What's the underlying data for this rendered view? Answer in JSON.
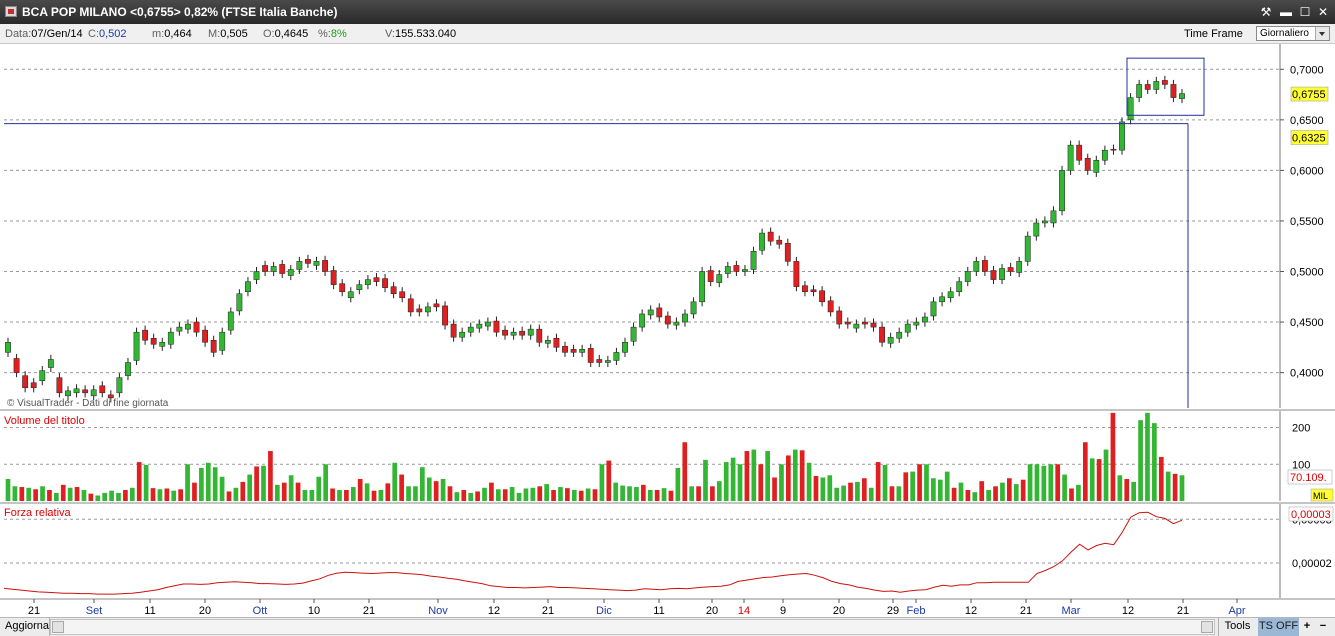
{
  "window": {
    "title": "BCA POP MILANO <0,6755> 0,82%  (FTSE Italia Banche)",
    "controls": {
      "tool": "⚒",
      "minimize": "▬",
      "maximize": "☐",
      "close": "✕"
    }
  },
  "infobar": {
    "data_label": "Data:",
    "data_value": "07/Gen/14",
    "c_label": "C:",
    "c_value": "0,502",
    "m_label": "m:",
    "m_value": "0,464",
    "M_label": "M:",
    "M_value": "0,505",
    "o_label": "O:",
    "o_value": "0,4645",
    "pct_label": "%:",
    "pct_value": "8%",
    "v_label": "V:",
    "v_value": "155.533.040",
    "timeframe_label": "Time Frame",
    "timeframe_value": "Giornaliero"
  },
  "colors": {
    "up": "#33b633",
    "down": "#e02020",
    "grid": "#9a9a9a",
    "rs_line": "#cc1010",
    "label_red": "#dd0000",
    "highlight": "#ffff33",
    "box": "#2030a0"
  },
  "chart_data": [
    {
      "type": "candlestick",
      "watermark": "© VisualTrader - Dati di fine giornata",
      "y_ticks": [
        "0,4000",
        "0,4500",
        "0,5000",
        "0,5500",
        "0,6000",
        "0,6500",
        "0,7000"
      ],
      "ylim": [
        0.365,
        0.725
      ],
      "current_price_label": "0,6755",
      "level_label": "0,6325",
      "x_labels": [
        {
          "label": "21",
          "color": "black"
        },
        {
          "label": "Set",
          "color": "blue"
        },
        {
          "label": "11",
          "color": "black"
        },
        {
          "label": "20",
          "color": "black"
        },
        {
          "label": "Ott",
          "color": "blue"
        },
        {
          "label": "10",
          "color": "black"
        },
        {
          "label": "21",
          "color": "black"
        },
        {
          "label": "Nov",
          "color": "blue"
        },
        {
          "label": "12",
          "color": "black"
        },
        {
          "label": "21",
          "color": "black"
        },
        {
          "label": "Dic",
          "color": "blue"
        },
        {
          "label": "11",
          "color": "black"
        },
        {
          "label": "20",
          "color": "black"
        },
        {
          "label": "14",
          "color": "red"
        },
        {
          "label": "9",
          "color": "black"
        },
        {
          "label": "20",
          "color": "black"
        },
        {
          "label": "29",
          "color": "black"
        },
        {
          "label": "Feb",
          "color": "blue"
        },
        {
          "label": "12",
          "color": "black"
        },
        {
          "label": "21",
          "color": "black"
        },
        {
          "label": "Mar",
          "color": "blue"
        },
        {
          "label": "12",
          "color": "black"
        },
        {
          "label": "21",
          "color": "black"
        },
        {
          "label": "Apr",
          "color": "blue"
        }
      ],
      "close": [
        0.42,
        0.4,
        0.385,
        0.39,
        0.402,
        0.405,
        0.38,
        0.382,
        0.384,
        0.38,
        0.383,
        0.38,
        0.378,
        0.395,
        0.41,
        0.44,
        0.432,
        0.428,
        0.43,
        0.44,
        0.445,
        0.448,
        0.44,
        0.43,
        0.42,
        0.44,
        0.46,
        0.478,
        0.49,
        0.5,
        0.5,
        0.505,
        0.498,
        0.502,
        0.51,
        0.508,
        0.51,
        0.5,
        0.487,
        0.48,
        0.48,
        0.487,
        0.492,
        0.49,
        0.484,
        0.478,
        0.474,
        0.46,
        0.46,
        0.465,
        0.465,
        0.447,
        0.435,
        0.44,
        0.445,
        0.448,
        0.45,
        0.44,
        0.437,
        0.44,
        0.437,
        0.443,
        0.43,
        0.432,
        0.425,
        0.42,
        0.42,
        0.423,
        0.41,
        0.41,
        0.412,
        0.42,
        0.43,
        0.445,
        0.458,
        0.462,
        0.455,
        0.448,
        0.45,
        0.458,
        0.47,
        0.5,
        0.49,
        0.497,
        0.505,
        0.5,
        0.502,
        0.52,
        0.538,
        0.53,
        0.527,
        0.51,
        0.485,
        0.48,
        0.48,
        0.47,
        0.46,
        0.448,
        0.448,
        0.448,
        0.448,
        0.445,
        0.43,
        0.435,
        0.44,
        0.448,
        0.45,
        0.455,
        0.47,
        0.475,
        0.48,
        0.49,
        0.5,
        0.51,
        0.5,
        0.492,
        0.503,
        0.5,
        0.51,
        0.535,
        0.548,
        0.548,
        0.56,
        0.6,
        0.625,
        0.61,
        0.6,
        0.61,
        0.62,
        0.62,
        0.648,
        0.672,
        0.685,
        0.68,
        0.688,
        0.685,
        0.672,
        0.676
      ],
      "open_offset": [
        0.01,
        0.014,
        0.012,
        -0.005,
        -0.01,
        0.008,
        0.015,
        -0.005,
        -0.004,
        0.003,
        -0.006,
        0.007,
        -0.003,
        -0.015,
        -0.013,
        -0.028,
        0.01,
        0.006,
        -0.004,
        -0.012,
        -0.004,
        -0.005,
        0.01,
        0.012,
        0.012,
        -0.018,
        -0.018,
        -0.017,
        -0.01,
        -0.008,
        0.006,
        -0.005,
        0.009,
        -0.006,
        -0.008,
        0.004,
        -0.004,
        0.011,
        0.014,
        0.008,
        -0.006,
        -0.005,
        -0.005,
        0.004,
        0.009,
        0.007,
        0.006,
        0.013,
        0.003,
        -0.005,
        0.003,
        0.019,
        0.013,
        -0.005,
        -0.005,
        -0.004,
        -0.004,
        0.011,
        0.005,
        -0.003,
        0.004,
        -0.006,
        0.013,
        -0.003,
        0.009,
        0.006,
        0.003,
        -0.003,
        0.014,
        0.003,
        -0.002,
        -0.008,
        -0.01,
        -0.014,
        -0.013,
        -0.005,
        0.009,
        0.008,
        -0.003,
        -0.008,
        -0.012,
        -0.03,
        0.011,
        -0.008,
        -0.007,
        0.006,
        -0.002,
        -0.018,
        -0.017,
        0.009,
        0.004,
        0.018,
        0.025,
        0.006,
        0.002,
        0.011,
        0.011,
        0.013,
        0.002,
        -0.004,
        0.002,
        0.004,
        0.015,
        -0.006,
        -0.006,
        -0.008,
        -0.003,
        -0.005,
        -0.014,
        -0.005,
        -0.006,
        -0.01,
        -0.01,
        -0.01,
        0.011,
        0.009,
        -0.011,
        0.004,
        -0.011,
        -0.025,
        -0.013,
        0.002,
        -0.012,
        -0.04,
        -0.025,
        0.015,
        0.012,
        -0.012,
        -0.01,
        0.001,
        -0.028,
        -0.022,
        -0.013,
        0.005,
        -0.008,
        0.004,
        0.013,
        -0.005
      ],
      "direction": [
        "up",
        "down",
        "down",
        "down",
        "up",
        "up",
        "down",
        "up",
        "up",
        "down",
        "up",
        "down",
        "down",
        "up",
        "up",
        "up",
        "down",
        "down",
        "up",
        "up",
        "up",
        "up",
        "down",
        "down",
        "down",
        "up",
        "up",
        "up",
        "up",
        "up",
        "down",
        "up",
        "down",
        "up",
        "up",
        "down",
        "up",
        "down",
        "down",
        "down",
        "up",
        "up",
        "up",
        "down",
        "down",
        "down",
        "down",
        "down",
        "down",
        "up",
        "down",
        "down",
        "down",
        "up",
        "up",
        "up",
        "up",
        "down",
        "down",
        "up",
        "down",
        "up",
        "down",
        "up",
        "down",
        "down",
        "down",
        "up",
        "down",
        "down",
        "up",
        "up",
        "up",
        "up",
        "up",
        "up",
        "down",
        "down",
        "up",
        "up",
        "up",
        "up",
        "down",
        "up",
        "up",
        "down",
        "up",
        "up",
        "up",
        "down",
        "down",
        "down",
        "down",
        "down",
        "down",
        "down",
        "down",
        "down",
        "down",
        "up",
        "down",
        "down",
        "down",
        "up",
        "up",
        "up",
        "up",
        "up",
        "up",
        "up",
        "up",
        "up",
        "up",
        "up",
        "down",
        "down",
        "up",
        "down",
        "up",
        "up",
        "up",
        "up",
        "up",
        "up",
        "up",
        "down",
        "down",
        "up",
        "up",
        "down",
        "up",
        "up",
        "up",
        "down",
        "up",
        "down",
        "down",
        "up"
      ]
    },
    {
      "type": "bar",
      "label": "Volume del titolo",
      "y_ticks": [
        "100",
        "200"
      ],
      "ylim": [
        0,
        245
      ],
      "last_value_label": "70.109.",
      "unit_label": "MIL",
      "values": [
        60,
        40,
        38,
        36,
        32,
        40,
        30,
        22,
        44,
        36,
        38,
        30,
        20,
        15,
        22,
        28,
        22,
        30,
        36,
        106,
        98,
        35,
        32,
        34,
        28,
        32,
        100,
        50,
        90,
        104,
        92,
        66,
        26,
        36,
        52,
        72,
        94,
        96,
        136,
        44,
        50,
        70,
        50,
        30,
        30,
        66,
        100,
        34,
        30,
        30,
        38,
        60,
        48,
        28,
        30,
        48,
        104,
        72,
        40,
        40,
        92,
        64,
        54,
        60,
        40,
        24,
        30,
        22,
        26,
        36,
        50,
        32,
        32,
        38,
        22,
        34,
        36,
        40,
        46,
        30,
        38,
        35,
        30,
        28,
        34,
        32,
        100,
        110,
        50,
        42,
        40,
        38,
        44,
        30,
        30,
        35,
        28,
        90,
        160,
        40,
        40,
        112,
        40,
        54,
        106,
        118,
        100,
        136,
        140,
        100,
        136,
        64,
        100,
        124,
        140,
        138,
        104,
        68,
        64,
        70,
        36,
        42,
        50,
        52,
        62,
        36,
        106,
        98,
        40,
        40,
        78,
        80,
        100,
        100,
        62,
        58,
        80,
        36,
        50,
        30,
        24,
        54,
        30,
        40,
        50,
        62,
        46,
        58,
        100,
        100,
        96,
        100,
        100,
        72,
        34,
        44,
        160,
        116,
        114,
        140,
        240,
        70,
        60,
        52,
        220,
        240,
        212,
        120,
        80,
        74,
        70
      ]
    },
    {
      "type": "line",
      "label": "Forza relativa",
      "y_ticks": [
        "0,00002",
        "0,00003"
      ],
      "ylim": [
        1.2e-05,
        3.35e-05
      ],
      "last_value_label": "0,00003",
      "values": [
        1.42e-05,
        1.4e-05,
        1.38e-05,
        1.36e-05,
        1.34e-05,
        1.33e-05,
        1.32e-05,
        1.31e-05,
        1.31e-05,
        1.3e-05,
        1.3e-05,
        1.29e-05,
        1.29e-05,
        1.29e-05,
        1.3e-05,
        1.31e-05,
        1.33e-05,
        1.36e-05,
        1.39e-05,
        1.44e-05,
        1.48e-05,
        1.52e-05,
        1.52e-05,
        1.51e-05,
        1.52e-05,
        1.55e-05,
        1.56e-05,
        1.57e-05,
        1.56e-05,
        1.55e-05,
        1.53e-05,
        1.53e-05,
        1.52e-05,
        1.51e-05,
        1.52e-05,
        1.54e-05,
        1.59e-05,
        1.64e-05,
        1.72e-05,
        1.77e-05,
        1.79e-05,
        1.78e-05,
        1.77e-05,
        1.76e-05,
        1.77e-05,
        1.78e-05,
        1.78e-05,
        1.76e-05,
        1.75e-05,
        1.73e-05,
        1.7e-05,
        1.68e-05,
        1.65e-05,
        1.63e-05,
        1.59e-05,
        1.56e-05,
        1.53e-05,
        1.48e-05,
        1.46e-05,
        1.44e-05,
        1.44e-05,
        1.43e-05,
        1.44e-05,
        1.45e-05,
        1.46e-05,
        1.44e-05,
        1.44e-05,
        1.43e-05,
        1.42e-05,
        1.41e-05,
        1.4e-05,
        1.39e-05,
        1.38e-05,
        1.37e-05,
        1.38e-05,
        1.41e-05,
        1.4e-05,
        1.39e-05,
        1.41e-05,
        1.42e-05,
        1.41e-05,
        1.43e-05,
        1.45e-05,
        1.46e-05,
        1.47e-05,
        1.5e-05,
        1.58e-05,
        1.61e-05,
        1.64e-05,
        1.67e-05,
        1.68e-05,
        1.71e-05,
        1.73e-05,
        1.75e-05,
        1.76e-05,
        1.72e-05,
        1.66e-05,
        1.58e-05,
        1.53e-05,
        1.5e-05,
        1.45e-05,
        1.42e-05,
        1.38e-05,
        1.35e-05,
        1.36e-05,
        1.33e-05,
        1.36e-05,
        1.38e-05,
        1.39e-05,
        1.45e-05,
        1.49e-05,
        1.47e-05,
        1.5e-05,
        1.5e-05,
        1.55e-05,
        1.55e-05,
        1.56e-05,
        1.56e-05,
        1.56e-05,
        1.56e-05,
        1.56e-05,
        1.76e-05,
        1.83e-05,
        1.92e-05,
        2.05e-05,
        2.25e-05,
        2.43e-05,
        2.3e-05,
        2.4e-05,
        2.45e-05,
        2.42e-05,
        2.7e-05,
        3.05e-05,
        3.15e-05,
        3.16e-05,
        3.06e-05,
        3.02e-05,
        2.9e-05,
        2.98e-05
      ]
    }
  ],
  "bottombar": {
    "refresh_label": "Aggiorna",
    "tools_label": "Tools",
    "ts_label": "TS OFF",
    "zoom_in": "+",
    "zoom_out": "−"
  }
}
